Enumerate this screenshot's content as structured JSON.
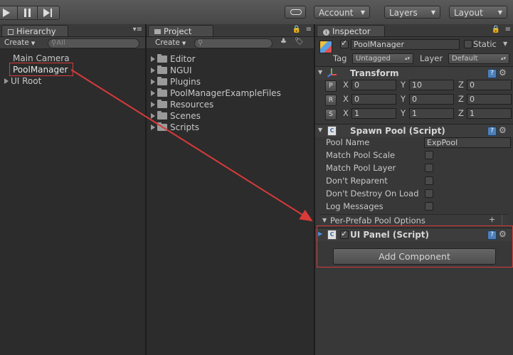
{
  "toolbar": {
    "play_icon": "play-icon",
    "pause_icon": "pause-icon",
    "step_icon": "step-icon",
    "cloud_icon": "cloud-icon",
    "account_label": "Account",
    "layers_label": "Layers",
    "layout_label": "Layout"
  },
  "hierarchy": {
    "tab_label": "Hierarchy",
    "create_label": "Create",
    "search_placeholder": "All",
    "items": [
      "Main Camera",
      "PoolManager",
      "UI Root"
    ]
  },
  "project": {
    "tab_label": "Project",
    "create_label": "Create",
    "folders": [
      "Editor",
      "NGUI",
      "Plugins",
      "PoolManagerExampleFiles",
      "Resources",
      "Scenes",
      "Scripts"
    ]
  },
  "inspector": {
    "tab_label": "Inspector",
    "object_name": "PoolManager",
    "static_label": "Static",
    "tag_label": "Tag",
    "tag_value": "Untagged",
    "layer_label": "Layer",
    "layer_value": "Default",
    "transform": {
      "title": "Transform",
      "rows": [
        {
          "btn": "P",
          "x": "0",
          "y": "10",
          "z": "0"
        },
        {
          "btn": "R",
          "x": "0",
          "y": "0",
          "z": "0"
        },
        {
          "btn": "S",
          "x": "1",
          "y": "1",
          "z": "1"
        }
      ],
      "x_label": "X",
      "y_label": "Y",
      "z_label": "Z"
    },
    "spawn_pool": {
      "title": "Spawn Pool (Script)",
      "pool_name_label": "Pool Name",
      "pool_name_value": "ExpPool",
      "match_pool_scale": "Match Pool Scale",
      "match_pool_layer": "Match Pool Layer",
      "dont_reparent": "Don't Reparent",
      "dont_destroy_on_load": "Don't Destroy On Load",
      "log_messages": "Log Messages",
      "per_prefab": "Per-Prefab Pool Options",
      "plus": "+"
    },
    "ui_panel": {
      "title": "UI Panel (Script)"
    },
    "add_component_label": "Add Component"
  },
  "colors": {
    "annotation_red": "#d93a3a",
    "panel_bg": "#2c2c2c"
  }
}
